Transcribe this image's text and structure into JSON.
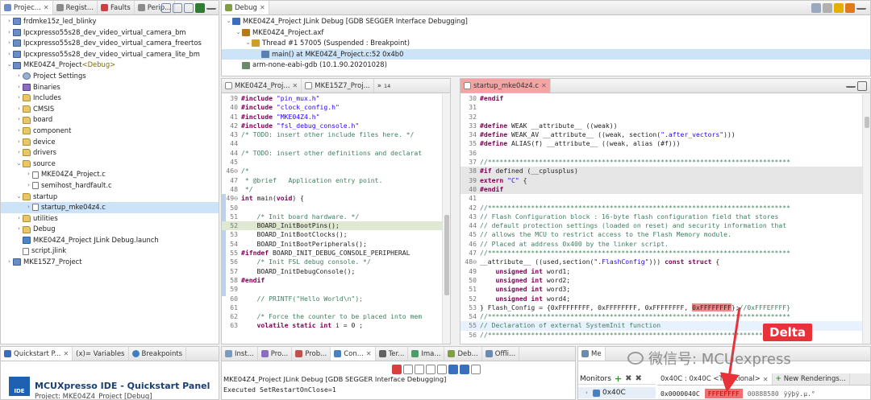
{
  "project_explorer": {
    "tabs": [
      {
        "label": "Projec...",
        "color": "#6a8cc7"
      },
      {
        "label": "Regist...",
        "color": "#8a8a8a"
      },
      {
        "label": "Faults",
        "color": "#d04040"
      },
      {
        "label": "Perip...",
        "color": "#8a8a8a"
      }
    ],
    "items": [
      {
        "label": "frdmke15z_led_blinky",
        "indent": 0,
        "arrow": "›",
        "icon": "proj"
      },
      {
        "label": "lpcxpresso55s28_dev_video_virtual_camera_bm",
        "indent": 0,
        "arrow": "›",
        "icon": "proj"
      },
      {
        "label": "lpcxpresso55s28_dev_video_virtual_camera_freertos",
        "indent": 0,
        "arrow": "›",
        "icon": "proj"
      },
      {
        "label": "lpcxpresso55s28_dev_video_virtual_camera_lite_bm",
        "indent": 0,
        "arrow": "›",
        "icon": "proj"
      },
      {
        "label": "MKE04Z4_Project",
        "suffix": "<Debug>",
        "indent": 0,
        "arrow": "⌄",
        "icon": "proj"
      },
      {
        "label": "Project Settings",
        "indent": 1,
        "arrow": "›",
        "icon": "gear"
      },
      {
        "label": "Binaries",
        "indent": 1,
        "arrow": "›",
        "icon": "bin"
      },
      {
        "label": "Includes",
        "indent": 1,
        "arrow": "›",
        "icon": "fold"
      },
      {
        "label": "CMSIS",
        "indent": 1,
        "arrow": "›",
        "icon": "fold"
      },
      {
        "label": "board",
        "indent": 1,
        "arrow": "›",
        "icon": "fold"
      },
      {
        "label": "component",
        "indent": 1,
        "arrow": "›",
        "icon": "fold"
      },
      {
        "label": "device",
        "indent": 1,
        "arrow": "›",
        "icon": "fold"
      },
      {
        "label": "drivers",
        "indent": 1,
        "arrow": "›",
        "icon": "fold"
      },
      {
        "label": "source",
        "indent": 1,
        "arrow": "⌄",
        "icon": "fold"
      },
      {
        "label": "MKE04Z4_Project.c",
        "indent": 2,
        "arrow": "›",
        "icon": "file"
      },
      {
        "label": "semihost_hardfault.c",
        "indent": 2,
        "arrow": "›",
        "icon": "file"
      },
      {
        "label": "startup",
        "indent": 1,
        "arrow": "⌄",
        "icon": "fold"
      },
      {
        "label": "startup_mke04z4.c",
        "indent": 2,
        "arrow": "›",
        "icon": "file",
        "selected": true
      },
      {
        "label": "utilities",
        "indent": 1,
        "arrow": "›",
        "icon": "fold"
      },
      {
        "label": "Debug",
        "indent": 1,
        "arrow": "›",
        "icon": "fold"
      },
      {
        "label": "MKE04Z4_Project JLink Debug.launch",
        "indent": 1,
        "arrow": "",
        "icon": "launch"
      },
      {
        "label": "script.jlink",
        "indent": 1,
        "arrow": "",
        "icon": "file"
      },
      {
        "label": "MKE15Z7_Project",
        "indent": 0,
        "arrow": "›",
        "icon": "proj"
      }
    ]
  },
  "debug_view": {
    "tab": "Debug",
    "items": [
      {
        "label": "MKE04Z4_Project JLink Debug [GDB SEGGER Interface Debugging]",
        "indent": 0,
        "arrow": "⌄",
        "icon": "#3a6fc0"
      },
      {
        "label": "MKE04Z4_Project.axf",
        "indent": 1,
        "arrow": "⌄",
        "icon": "#b57a1a"
      },
      {
        "label": "Thread #1 57005 (Suspended : Breakpoint)",
        "indent": 2,
        "arrow": "⌄",
        "icon": "#d0a020"
      },
      {
        "label": "main() at MKE04Z4_Project.c:52 0x4b0",
        "indent": 3,
        "arrow": "",
        "icon": "#5a7fb0",
        "selected": true
      },
      {
        "label": "arm-none-eabi-gdb (10.1.90.20201028)",
        "indent": 1,
        "arrow": "",
        "icon": "#6a8a6a"
      }
    ]
  },
  "editor_left": {
    "tabs": [
      "MKE04Z4_Proj...",
      "MKE15Z7_Proj..."
    ],
    "overflow": "»",
    "overflow_count": "14",
    "lines": [
      [
        {
          "n": "39"
        },
        {
          "t": "#include ",
          "c": "pp"
        },
        {
          "t": "\"pin_mux.h\"",
          "c": "str"
        }
      ],
      [
        {
          "n": "40"
        },
        {
          "t": "#include ",
          "c": "pp"
        },
        {
          "t": "\"clock_config.h\"",
          "c": "str"
        }
      ],
      [
        {
          "n": "41"
        },
        {
          "t": "#include ",
          "c": "pp"
        },
        {
          "t": "\"MKE04Z4.h\"",
          "c": "str"
        }
      ],
      [
        {
          "n": "42"
        },
        {
          "t": "#include ",
          "c": "pp"
        },
        {
          "t": "\"fsl_debug_console.h\"",
          "c": "str"
        }
      ],
      [
        {
          "n": "43",
          "m": "task"
        },
        {
          "t": "/* TODO: insert other include files here. */",
          "c": "cm"
        }
      ],
      [
        {
          "n": "44"
        },
        {
          "t": "",
          "c": ""
        }
      ],
      [
        {
          "n": "44",
          "m": "task"
        },
        {
          "t": "/* TODO: insert other definitions and declarat",
          "c": "cm"
        }
      ],
      [
        {
          "n": "45"
        },
        {
          "t": "",
          "c": ""
        }
      ],
      [
        {
          "n": "46⊖"
        },
        {
          "t": "/*",
          "c": "cm"
        }
      ],
      [
        {
          "n": "47"
        },
        {
          "t": " * @brief   Application entry point.",
          "c": "cm"
        }
      ],
      [
        {
          "n": "48"
        },
        {
          "t": " */",
          "c": "cm"
        }
      ],
      [
        {
          "n": "49⊖"
        },
        {
          "t": "int ",
          "c": "kw"
        },
        {
          "t": "main(",
          "c": ""
        },
        {
          "t": "void",
          "c": "kw"
        },
        {
          "t": ") {",
          "c": ""
        }
      ],
      [
        {
          "n": "50"
        },
        {
          "t": "",
          "c": ""
        }
      ],
      [
        {
          "n": "51"
        },
        {
          "t": "    /* Init board hardware. */",
          "c": "cm"
        }
      ],
      [
        {
          "n": "52",
          "m": "pc",
          "bg": "hlg"
        },
        {
          "t": "    BOARD_InitBootPins();",
          "c": ""
        }
      ],
      [
        {
          "n": "53"
        },
        {
          "t": "    BOARD_InitBootClocks();",
          "c": ""
        }
      ],
      [
        {
          "n": "54"
        },
        {
          "t": "    BOARD_InitBootPeripherals();",
          "c": ""
        }
      ],
      [
        {
          "n": "55"
        },
        {
          "t": "#ifndef ",
          "c": "pp"
        },
        {
          "t": "BOARD_INIT_DEBUG_CONSOLE_PERIPHERAL",
          "c": ""
        }
      ],
      [
        {
          "n": "56"
        },
        {
          "t": "    /* Init FSL debug console. */",
          "c": "cm"
        }
      ],
      [
        {
          "n": "57"
        },
        {
          "t": "    BOARD_InitDebugConsole();",
          "c": ""
        }
      ],
      [
        {
          "n": "58"
        },
        {
          "t": "#endif",
          "c": "pp"
        }
      ],
      [
        {
          "n": "59"
        },
        {
          "t": "",
          "c": ""
        }
      ],
      [
        {
          "n": "60"
        },
        {
          "t": "    // PRINTF(\"Hello World\\n\");",
          "c": "cm"
        }
      ],
      [
        {
          "n": "61"
        },
        {
          "t": "",
          "c": ""
        }
      ],
      [
        {
          "n": "62"
        },
        {
          "t": "    /* Force the counter to be placed into mem",
          "c": "cm"
        }
      ],
      [
        {
          "n": "63"
        },
        {
          "t": "    ",
          "c": ""
        },
        {
          "t": "volatile static int ",
          "c": "kw"
        },
        {
          "t": "i = 0 ;",
          "c": ""
        }
      ]
    ]
  },
  "editor_right": {
    "tab": "startup_mke04z4.c",
    "lines": [
      [
        {
          "n": "30"
        },
        {
          "t": "#endif",
          "c": "pp"
        }
      ],
      [
        {
          "n": "31"
        },
        {
          "t": "",
          "c": ""
        }
      ],
      [
        {
          "n": "32"
        },
        {
          "t": "",
          "c": ""
        }
      ],
      [
        {
          "n": "33"
        },
        {
          "t": "#define ",
          "c": "pp"
        },
        {
          "t": "WEAK __attribute__ ((weak))",
          "c": ""
        }
      ],
      [
        {
          "n": "34"
        },
        {
          "t": "#define ",
          "c": "pp"
        },
        {
          "t": "WEAK_AV __attribute__ ((weak, section(",
          "c": ""
        },
        {
          "t": "\".after_vectors\"",
          "c": "str"
        },
        {
          "t": ")))",
          "c": ""
        }
      ],
      [
        {
          "n": "35"
        },
        {
          "t": "#define ",
          "c": "pp"
        },
        {
          "t": "ALIAS(f) __attribute__ ((weak, alias (#f)))",
          "c": ""
        }
      ],
      [
        {
          "n": "36"
        },
        {
          "t": "",
          "c": ""
        }
      ],
      [
        {
          "n": "37"
        },
        {
          "t": "//*****************************************************************************",
          "c": "cm"
        }
      ],
      [
        {
          "n": "38",
          "bg": "hl"
        },
        {
          "t": "#if ",
          "c": "pp"
        },
        {
          "t": "defined (__cplusplus)",
          "c": ""
        }
      ],
      [
        {
          "n": "39",
          "bg": "hl"
        },
        {
          "t": "extern ",
          "c": "kw"
        },
        {
          "t": "\"C\"",
          "c": "str"
        },
        {
          "t": " {",
          "c": ""
        }
      ],
      [
        {
          "n": "40",
          "bg": "hl"
        },
        {
          "t": "#endif",
          "c": "pp"
        }
      ],
      [
        {
          "n": "41"
        },
        {
          "t": "",
          "c": ""
        }
      ],
      [
        {
          "n": "42"
        },
        {
          "t": "//*****************************************************************************",
          "c": "cm"
        }
      ],
      [
        {
          "n": "43"
        },
        {
          "t": "// Flash Configuration block : 16-byte flash configuration field that stores",
          "c": "cm"
        }
      ],
      [
        {
          "n": "44"
        },
        {
          "t": "// default protection settings (loaded on reset) and security information that",
          "c": "cm"
        }
      ],
      [
        {
          "n": "45"
        },
        {
          "t": "// allows the MCU to restrict access to the Flash Memory module.",
          "c": "cm"
        }
      ],
      [
        {
          "n": "46"
        },
        {
          "t": "// Placed at address 0x400 by the linker script.",
          "c": "cm"
        }
      ],
      [
        {
          "n": "47"
        },
        {
          "t": "//*****************************************************************************",
          "c": "cm"
        }
      ],
      [
        {
          "n": "48⊖"
        },
        {
          "t": "__attribute__ ((used,section(",
          "c": ""
        },
        {
          "t": "\".FlashConfig\"",
          "c": "str"
        },
        {
          "t": "))) ",
          "c": ""
        },
        {
          "t": "const struct ",
          "c": "kw"
        },
        {
          "t": "{",
          "c": ""
        }
      ],
      [
        {
          "n": "49"
        },
        {
          "t": "    ",
          "c": ""
        },
        {
          "t": "unsigned int ",
          "c": "kw"
        },
        {
          "t": "word1;",
          "c": ""
        }
      ],
      [
        {
          "n": "50"
        },
        {
          "t": "    ",
          "c": ""
        },
        {
          "t": "unsigned int ",
          "c": "kw"
        },
        {
          "t": "word2;",
          "c": ""
        }
      ],
      [
        {
          "n": "51"
        },
        {
          "t": "    ",
          "c": ""
        },
        {
          "t": "unsigned int ",
          "c": "kw"
        },
        {
          "t": "word3;",
          "c": ""
        }
      ],
      [
        {
          "n": "52"
        },
        {
          "t": "    ",
          "c": ""
        },
        {
          "t": "unsigned int ",
          "c": "kw"
        },
        {
          "t": "word4;",
          "c": ""
        }
      ],
      [
        {
          "n": "53"
        },
        {
          "t": "} Flash_Config = {0xFFFFFFFF, 0xFFFFFFFF, 0xFFFFFFFF, ",
          "c": ""
        },
        {
          "t": "0xFFFFFFFF",
          "c": "redbox"
        },
        {
          "t": "};",
          "c": ""
        },
        {
          "t": "//0xFFFEFFFF}",
          "c": "cm"
        }
      ],
      [
        {
          "n": "54"
        },
        {
          "t": "//*****************************************************************************",
          "c": "cm"
        }
      ],
      [
        {
          "n": "55",
          "bg": "cur"
        },
        {
          "t": "// Declaration of external SystemInit function",
          "c": "cm"
        }
      ],
      [
        {
          "n": "56"
        },
        {
          "t": "//*****************************************************************************",
          "c": "cm"
        }
      ]
    ]
  },
  "quickstart": {
    "tabs": [
      "Quickstart P...",
      "(x)= Variables",
      "Breakpoints"
    ],
    "logo": "IDE",
    "title": "MCUXpresso IDE - Quickstart Panel",
    "project": "Project: MKE04Z4_Project [Debug]"
  },
  "console": {
    "tabs": [
      "Inst...",
      "Pro...",
      "Prob...",
      "Con...",
      "Ter...",
      "Ima...",
      "Deb...",
      "Offli..."
    ],
    "title": "MKE04Z4_Project JLink Debug [GDB SEGGER Interface Debugging]",
    "text": "Executed SetRestartOnClose=1"
  },
  "memory": {
    "tab": "Me",
    "monitors_label": "Monitors",
    "monitor_item": "0x40C",
    "rendering_tab": "0x40C : 0x40C <Traditional>",
    "new_renderings": "New Renderings...",
    "address": "0x0000040C",
    "value_highlight": "FFFEFFFF",
    "value_next": "00888580",
    "ascii": "ÿÿþÿ.µ.°"
  },
  "annotation": {
    "label": "Delta",
    "color": "#e8323a"
  },
  "watermark": "微信号: MCUexpress"
}
